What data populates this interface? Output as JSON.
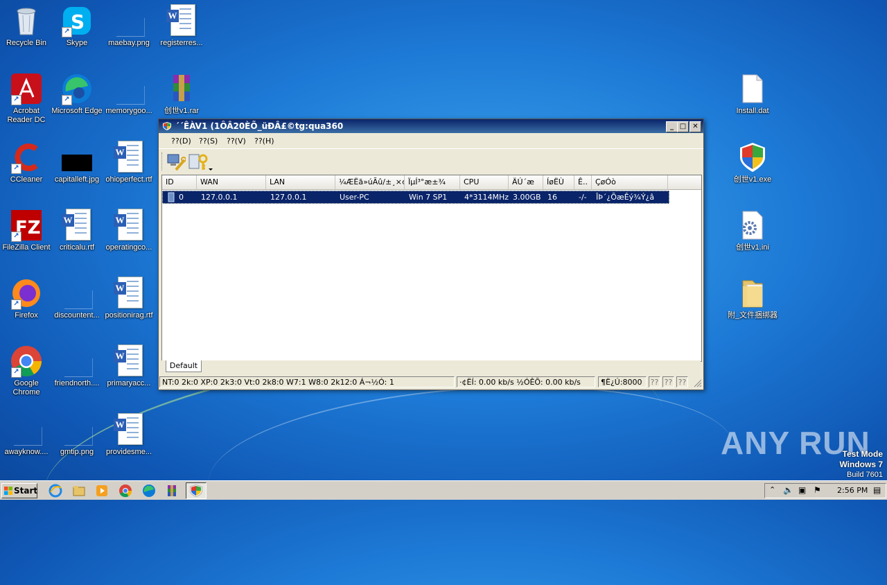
{
  "desktop": {
    "icons": [
      {
        "label": "Recycle Bin"
      },
      {
        "label": "Skype"
      },
      {
        "label": "maebay.png"
      },
      {
        "label": "registerres..."
      },
      {
        "label": "Acrobat Reader DC"
      },
      {
        "label": "Microsoft Edge"
      },
      {
        "label": "memorygoo..."
      },
      {
        "label": "创世v1.rar"
      },
      {
        "label": "CCleaner"
      },
      {
        "label": "capitalleft.jpg"
      },
      {
        "label": "ohioperfect.rtf"
      },
      {
        "label": "FileZilla Client"
      },
      {
        "label": "criticalu.rtf"
      },
      {
        "label": "operatingco..."
      },
      {
        "label": "Firefox"
      },
      {
        "label": "discountent..."
      },
      {
        "label": "positionirag.rtf"
      },
      {
        "label": "Google Chrome"
      },
      {
        "label": "friendnorth...."
      },
      {
        "label": "primaryacc..."
      },
      {
        "label": "awayknow...."
      },
      {
        "label": "gmtip.png"
      },
      {
        "label": "providesme..."
      },
      {
        "label": "Install.dat"
      },
      {
        "label": "创世v1.exe"
      },
      {
        "label": "创世v1.ini"
      },
      {
        "label": "附_文件捆绑器"
      }
    ]
  },
  "window": {
    "title": "´´ÊÀV1 (1ÔÂ20ÈÕ_üÐÂ£©tg:qua360",
    "menu": [
      "??(D)",
      "??(S)",
      "??(V)",
      "??(H)"
    ],
    "columns": [
      "ID",
      "WAN",
      "LAN",
      "¼ÆËã»úÃû/±¸×¢",
      "ÏµÍ³°æ±¾",
      "CPU",
      "ÄÚ´æ",
      "ÍøËÙ",
      "Ê..",
      "ÇøÓò"
    ],
    "rows": [
      {
        "id": "0",
        "wan": "127.0.0.1",
        "lan": "127.0.0.1",
        "host": "User-PC",
        "os": "Win 7 SP1",
        "cpu": "4*3114MHz",
        "mem": "3.00GB",
        "speed": "16",
        "cam": "-/-",
        "region": "ÎÞ´¿ÕæÊý¾Ý¿â"
      }
    ],
    "tab": "Default",
    "status": {
      "counts": "NT:0 2k:0 XP:0 2k3:0 Vt:0 2k8:0 W7:1 W8:0 2k12:0  Á¬½Ó: 1",
      "speed": "·¢ËÍ: 0.00 kb/s ½ÓÊÕ: 0.00 kb/s",
      "port": "¶Ë¿Ú:8000",
      "q1": "??",
      "q2": "??",
      "q3": "??"
    }
  },
  "taskbar": {
    "start": "Start",
    "clock": "2:56 PM"
  },
  "watermark": "ANY RUN",
  "testmode": {
    "line1": "Test Mode",
    "line2": "Windows 7",
    "line3": "Build 7601"
  }
}
